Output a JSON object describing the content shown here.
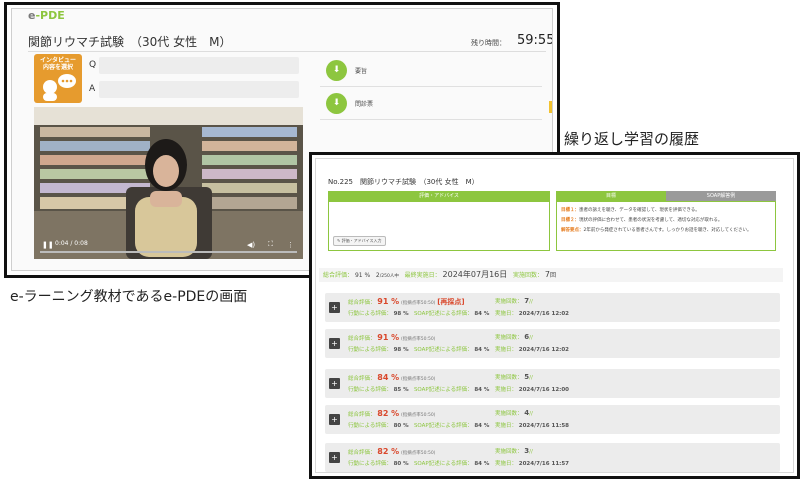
{
  "left_screen": {
    "logo": "e-PDE",
    "title": "関節リウマチ試験　（30代 女性　M）",
    "timer_label": "残り時間：",
    "timer_value": "59:55",
    "interview_button": {
      "line1": "インタビュー",
      "line2": "内容を選択"
    },
    "q_label": "Q",
    "a_label": "A",
    "video": {
      "time": "0:04 / 0:08"
    },
    "files": [
      {
        "label": "要旨"
      },
      {
        "label": "問診票"
      }
    ]
  },
  "captions": {
    "left": "e-ラーニング教材であるe-PDEの画面",
    "right": "繰り返し学習の履歴"
  },
  "right_screen": {
    "title": "No.225　関節リウマチ試験　（30代 女性　M）",
    "advice_header": "評価・アドバイス",
    "advice_edit_button": "評価・アドバイス入力",
    "goal_tab": "目標",
    "soap_tab": "SOAP解答例",
    "goals": [
      {
        "label": "目標１：",
        "text": "患者の訴えを聴き、データを確認して、現状を評価できる。"
      },
      {
        "label": "目標２：",
        "text": "現状の評価に合わせて、患者の状況を考慮して、適切な対応が取れる。"
      },
      {
        "label": "解答要点：",
        "text": "2年前から発症されている患者さんです。しっかりお話を聴き、対応してください。"
      }
    ],
    "summary": {
      "total_label": "総合評価：",
      "total_value": "91 %",
      "rank": "2",
      "rank_total": "/250人中",
      "last_date_label": "最終実施日：",
      "last_date": "2024年07月16日",
      "count_label": "実施回数：",
      "count_value": "7",
      "count_unit": "回"
    },
    "row_labels": {
      "total": "総合評価：",
      "range": "(指摘点率50:50)",
      "action": "行動による評価：",
      "soap": "SOAP記述による評価：",
      "count": "実施回数：",
      "date": "実施日："
    },
    "history": [
      {
        "total": "91 %",
        "flag": "[再採点]",
        "action": "98 %",
        "soap": "84 %",
        "count": "7",
        "count_suffix": "//",
        "date": "2024/7/16 12:02"
      },
      {
        "total": "91 %",
        "flag": "",
        "action": "98 %",
        "soap": "84 %",
        "count": "6",
        "count_suffix": "//",
        "date": "2024/7/16 12:02"
      },
      {
        "total": "84 %",
        "flag": "",
        "action": "85 %",
        "soap": "84 %",
        "count": "5",
        "count_suffix": "//",
        "date": "2024/7/16 12:00"
      },
      {
        "total": "82 %",
        "flag": "",
        "action": "80 %",
        "soap": "84 %",
        "count": "4",
        "count_suffix": "//",
        "date": "2024/7/16 11:58"
      },
      {
        "total": "82 %",
        "flag": "",
        "action": "80 %",
        "soap": "84 %",
        "count": "3",
        "count_suffix": "//",
        "date": "2024/7/16 11:57"
      }
    ]
  },
  "colors": {
    "accent_green": "#8dc63f",
    "interview_orange": "#e69b2e",
    "score_red": "#d9472b"
  },
  "icons": {
    "play": "pause-icon",
    "volume": "volume-icon",
    "fullscreen": "fullscreen-icon",
    "more": "more-icon",
    "file": "file-icon"
  }
}
